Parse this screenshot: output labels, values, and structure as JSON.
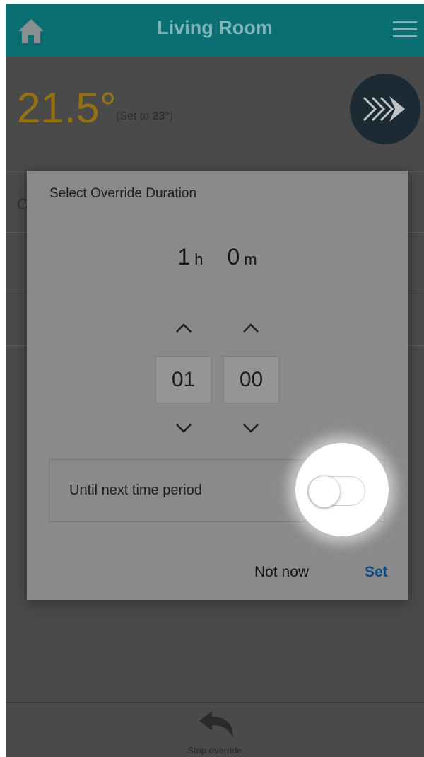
{
  "header": {
    "title": "Living Room",
    "left_icon": "home-icon",
    "right_icon": "menu-icon"
  },
  "status": {
    "current_temp": "21.5°",
    "set_prefix": "(Set to ",
    "set_value": "23°",
    "set_suffix": ")",
    "temp_color": "#947214"
  },
  "background_list": {
    "first_letter": "C"
  },
  "dialog": {
    "title": "Select Override Duration",
    "duration": {
      "hours": "1",
      "hours_unit": "h",
      "minutes": "0",
      "minutes_unit": "m"
    },
    "hours_box": "01",
    "minutes_box": "00",
    "toggle_label": "Until next time period",
    "toggle_on": false,
    "not_now_label": "Not now",
    "set_label": "Set",
    "set_color": "#0f4c85"
  },
  "footer": {
    "stop_label": "Stop override",
    "icon": "undo-icon"
  },
  "colors": {
    "topbar": "#0b6e72",
    "overlay": "#4a4a4a"
  }
}
